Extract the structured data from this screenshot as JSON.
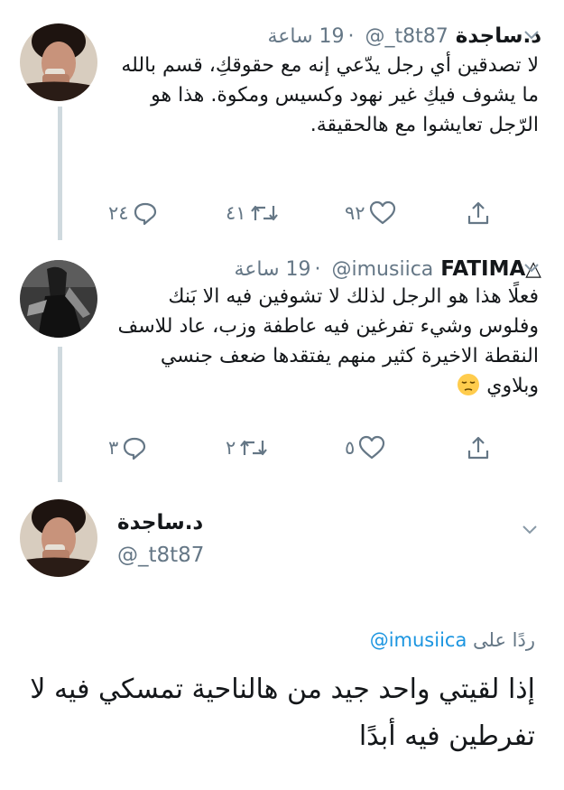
{
  "thread": [
    {
      "display_name": "د.ساجدة",
      "handle": "@_t8t87",
      "time": "19 ساعة",
      "text": "لا تصدقين أي رجل يدّعي إنه مع حقوقكِ، قسم بالله ما يشوف فيكِ غير نهود وكسيس ومكوة. هذا هو الرّجل تعايشوا مع هالحقيقة.",
      "replies": "٢٤",
      "retweets": "٤١",
      "likes": "٩٢"
    },
    {
      "display_name": "FATIMA",
      "display_prefix": "△",
      "handle": "@imusiica",
      "time": "19 ساعة",
      "text": "فعلًا هذا هو الرجل لذلك لا تشوفين فيه الا بَنك وفلوس وشيء تفرغين فيه عاطفة وزب، عاد للاسف النقطة الاخيرة كثير منهم يفتقدها ضعف جنسي وبلاوي",
      "emoji": "pensive-face",
      "replies": "٣",
      "retweets": "٢",
      "likes": "٥"
    }
  ],
  "focus_tweet": {
    "display_name": "د.ساجدة",
    "handle": "@_t8t87",
    "replying_label": "ردًا على",
    "replying_to": "@imusiica",
    "text": "إذا لقيتي واحد جيد من هالناحية تمسكي فيه لا تفرطين فيه أبدًا"
  },
  "icons": {
    "reply": "reply-icon",
    "retweet": "retweet-icon",
    "like": "heart-icon",
    "share": "share-icon",
    "menu": "chevron-down-icon"
  },
  "colors": {
    "text": "#14171a",
    "secondary": "#657786",
    "link": "#1b95e0",
    "thread_line": "#cfd9de"
  }
}
